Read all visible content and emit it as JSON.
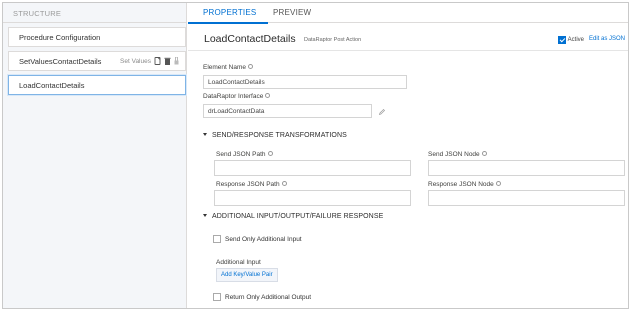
{
  "left": {
    "header": "STRUCTURE",
    "steps": [
      {
        "label": "Procedure Configuration"
      },
      {
        "label": "SetValuesContactDetails",
        "meta": "Set Values"
      },
      {
        "label": "LoadContactDetails"
      }
    ]
  },
  "tabs": [
    {
      "label": "PROPERTIES"
    },
    {
      "label": "PREVIEW"
    }
  ],
  "element": {
    "name": "LoadContactDetails",
    "type": "DataRaptor Post Action",
    "active_label": "Active",
    "edit_json": "Edit as JSON"
  },
  "fields": {
    "element_name_label": "Element Name",
    "element_name_value": "LoadContactDetails",
    "interface_label": "DataRaptor Interface",
    "interface_value": "drLoadContactData"
  },
  "send_response": {
    "title": "SEND/RESPONSE TRANSFORMATIONS",
    "send_json_path": "Send JSON Path",
    "send_json_node": "Send JSON Node",
    "response_json_path": "Response JSON Path",
    "response_json_node": "Response JSON Node"
  },
  "additional": {
    "title": "ADDITIONAL INPUT/OUTPUT/FAILURE RESPONSE",
    "send_only": "Send Only Additional Input",
    "additional_input": "Additional Input",
    "add_kv": "Add Key/Value Pair",
    "return_only": "Return Only Additional Output"
  },
  "colors": {
    "accent": "#0070d2",
    "panel_bg": "#f4f6f9"
  }
}
